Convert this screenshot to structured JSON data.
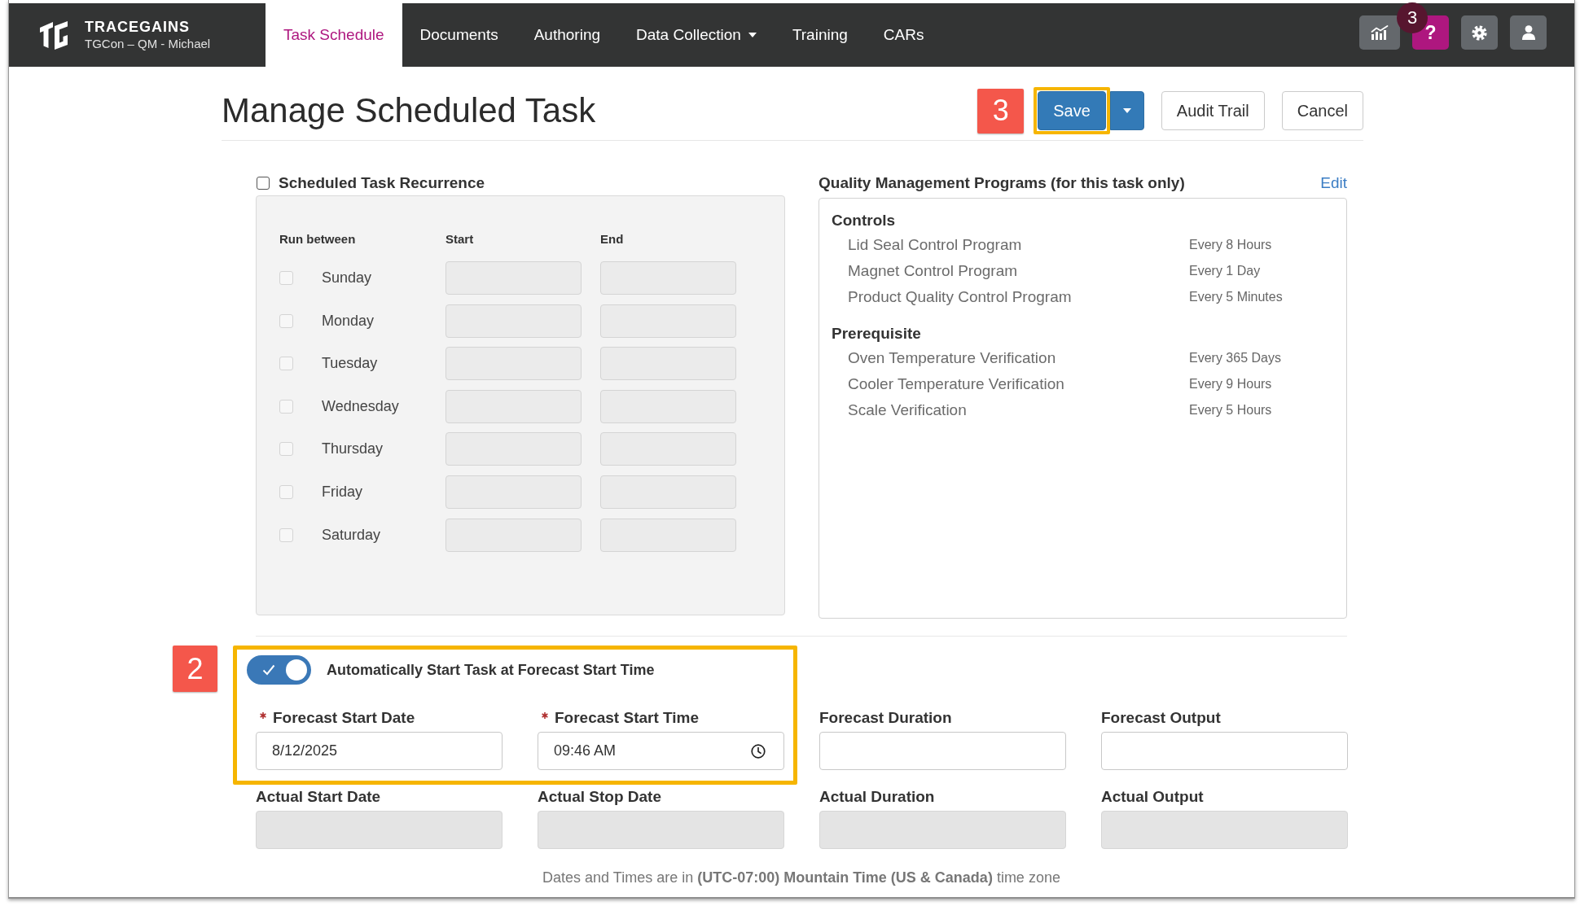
{
  "header": {
    "brand": {
      "name": "TRACEGAINS",
      "subtitle": "TGCon – QM - Michael"
    },
    "tabs": [
      {
        "label": "Task Schedule",
        "selected": true,
        "dropdown": false
      },
      {
        "label": "Documents",
        "selected": false,
        "dropdown": false
      },
      {
        "label": "Authoring",
        "selected": false,
        "dropdown": false
      },
      {
        "label": "Data Collection",
        "selected": false,
        "dropdown": true
      },
      {
        "label": "Training",
        "selected": false,
        "dropdown": false
      },
      {
        "label": "CARs",
        "selected": false,
        "dropdown": false
      }
    ],
    "tools": [
      {
        "kind": "chart",
        "color": "#64686c"
      },
      {
        "kind": "help",
        "label": "?",
        "color": "#ae177f",
        "badge": "3"
      },
      {
        "kind": "settings",
        "color": "#64686c"
      },
      {
        "kind": "user",
        "color": "#64686c"
      }
    ]
  },
  "page": {
    "title": "Manage Scheduled Task"
  },
  "toolbar": {
    "callout": "3",
    "buttons": [
      {
        "kind": "primary",
        "label": "Save",
        "highlighted": true
      },
      {
        "kind": "caret",
        "highlighted": false
      },
      {
        "kind": "default",
        "label": "Audit Trail",
        "highlighted": false
      },
      {
        "kind": "default",
        "label": "Cancel",
        "highlighted": false
      }
    ]
  },
  "recurrence": {
    "label": "Scheduled Task Recurrence",
    "checked": false,
    "disabled": true,
    "columns": [
      "Run between",
      "Start",
      "End"
    ],
    "days": [
      {
        "label": "Sunday",
        "checked": false
      },
      {
        "label": "Monday",
        "checked": false
      },
      {
        "label": "Tuesday",
        "checked": false
      },
      {
        "label": "Wednesday",
        "checked": false
      },
      {
        "label": "Thursday",
        "checked": false
      },
      {
        "label": "Friday",
        "checked": false
      },
      {
        "label": "Saturday",
        "checked": false
      }
    ]
  },
  "programs": {
    "title": "Quality Management Programs (for this task only)",
    "edit_link": "Edit",
    "groups": [
      {
        "name": "Controls",
        "items": [
          {
            "name": "Lid Seal Control Program",
            "frequency": "Every 8 Hours"
          },
          {
            "name": "Magnet Control Program",
            "frequency": "Every 1 Day"
          },
          {
            "name": "Product Quality Control Program",
            "frequency": "Every 5 Minutes"
          }
        ]
      },
      {
        "name": "Prerequisite",
        "items": [
          {
            "name": "Oven Temperature Verification",
            "frequency": "Every 365 Days"
          },
          {
            "name": "Cooler Temperature Verification",
            "frequency": "Every 9 Hours"
          },
          {
            "name": "Scale Verification",
            "frequency": "Every 5 Hours"
          }
        ]
      }
    ]
  },
  "auto_start": {
    "callout": "2",
    "highlighted": true,
    "toggle_on": true,
    "label": "Automatically Start Task at Forecast Start Time"
  },
  "fields": [
    {
      "label": "Forecast Start Date",
      "required": true,
      "kind": "text",
      "value": "8/12/2025",
      "disabled": false
    },
    {
      "label": "Forecast Start Time",
      "required": true,
      "kind": "time",
      "value": "09:46 AM",
      "disabled": false
    },
    {
      "label": "Forecast Duration",
      "required": false,
      "kind": "text",
      "disabled": false
    },
    {
      "label": "Forecast Output",
      "required": false,
      "kind": "text",
      "disabled": false
    },
    {
      "label": "Actual Start Date",
      "required": false,
      "kind": "text",
      "disabled": true
    },
    {
      "label": "Actual Stop Date",
      "required": false,
      "kind": "text",
      "disabled": true
    },
    {
      "label": "Actual Duration",
      "required": false,
      "kind": "text",
      "disabled": true
    },
    {
      "label": "Actual Output",
      "required": false,
      "kind": "text",
      "disabled": true
    }
  ],
  "footnote": "Dates and Times are in **(UTC-07:00) Mountain Time (US & Canada)** time zone"
}
